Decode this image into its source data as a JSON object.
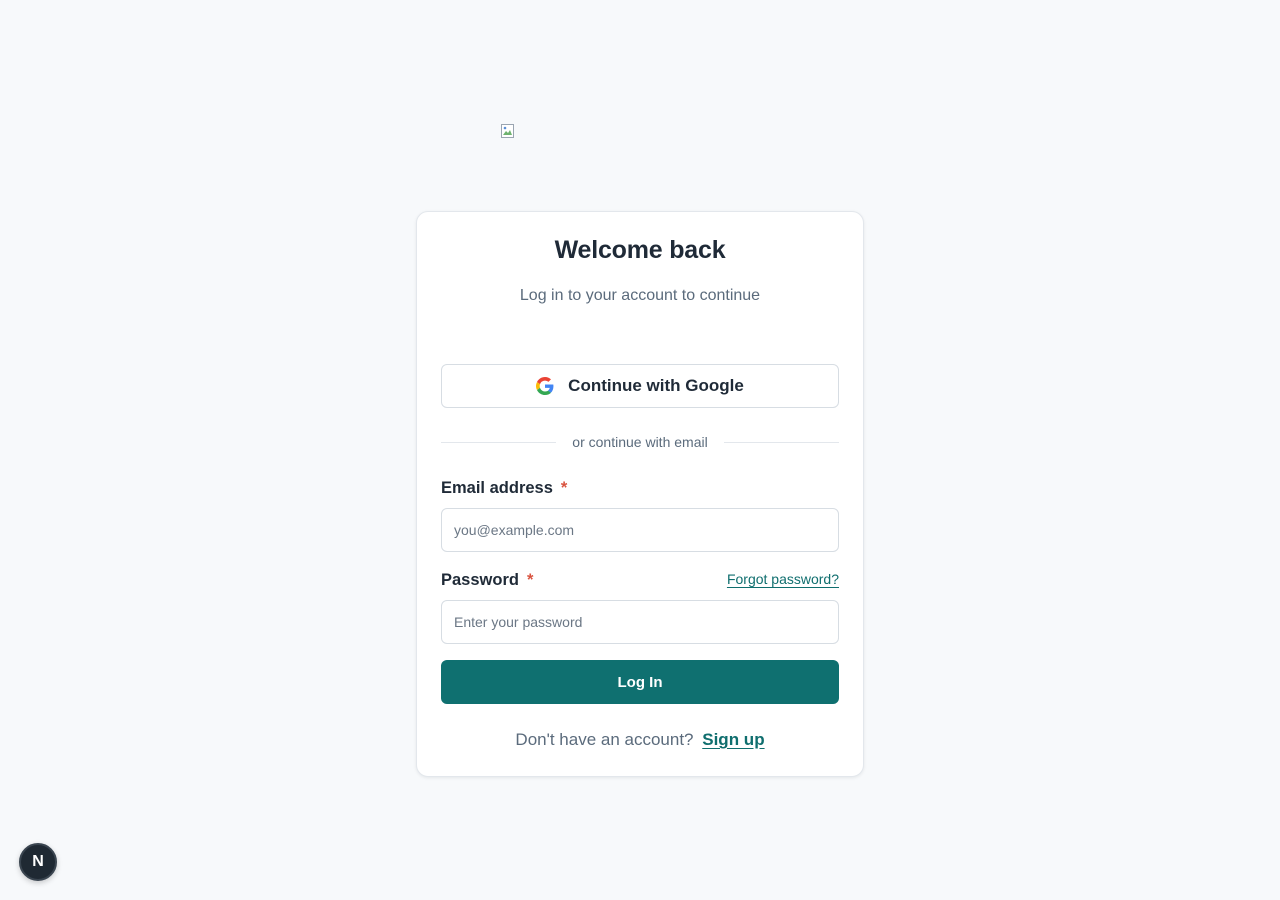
{
  "brand": {
    "logo_icon": "broken-image-icon"
  },
  "login": {
    "title": "Welcome back",
    "subtitle": "Log in to your account to continue",
    "google_button": {
      "label": "Continue with Google",
      "icon": "google-icon"
    },
    "divider_text": "or continue with email",
    "email": {
      "label": "Email address",
      "required_mark": "*",
      "placeholder": "you@example.com",
      "value": ""
    },
    "password": {
      "label": "Password",
      "required_mark": "*",
      "placeholder": "Enter your password",
      "value": "",
      "forgot_link": "Forgot password?"
    },
    "submit_label": "Log In",
    "signup_prompt": "Don't have an account?",
    "signup_link": "Sign up"
  },
  "dev_badge": {
    "label": "N"
  },
  "colors": {
    "background": "#f7f9fb",
    "accent": "#0f7070",
    "required": "#d9533f",
    "text": "#1f2a37",
    "muted": "#5b6b7c"
  }
}
